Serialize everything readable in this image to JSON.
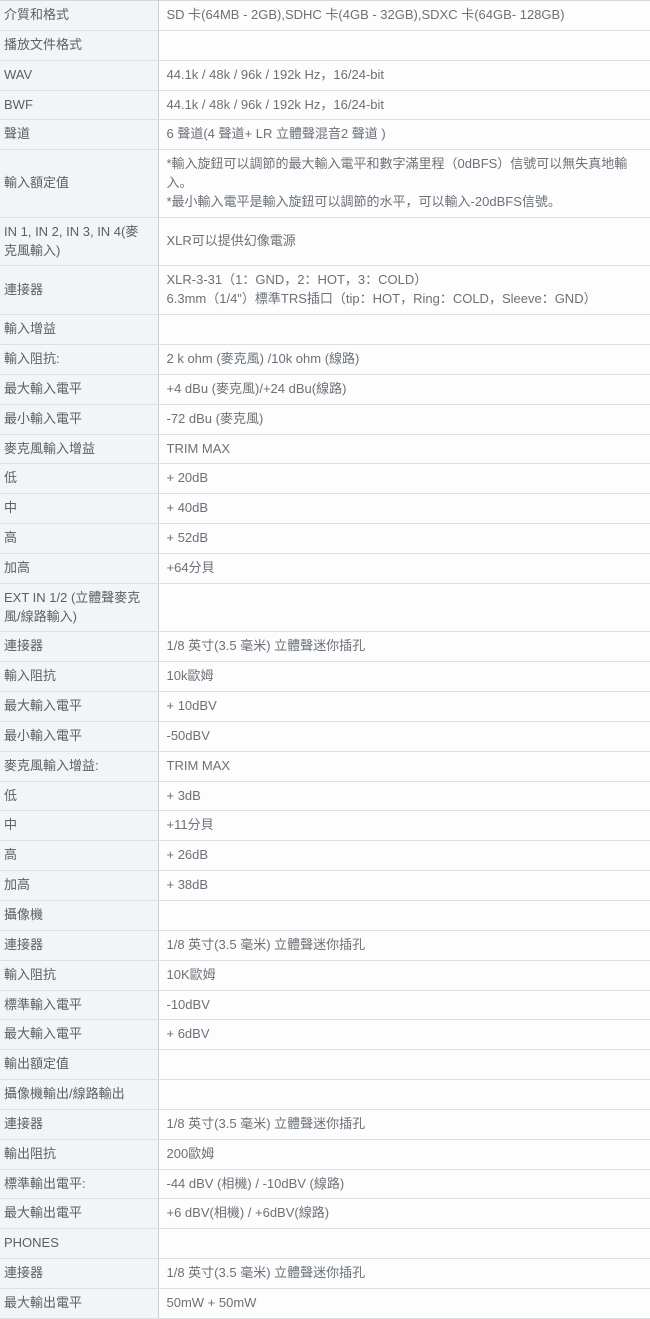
{
  "table": {
    "columns": [
      "spec-label",
      "spec-value"
    ],
    "rows": [
      {
        "type": "section-major",
        "label": "介質和格式",
        "value": "SD 卡(64MB - 2GB),SDHC 卡(4GB - 32GB),SDXC 卡(64GB- 128GB)"
      },
      {
        "type": "section-major",
        "label": "播放文件格式",
        "value": ""
      },
      {
        "type": "plain",
        "label": "WAV",
        "value": "44.1k / 48k / 96k / 192k Hz，16/24-bit"
      },
      {
        "type": "plain",
        "label": "BWF",
        "value": "44.1k / 48k / 96k / 192k Hz，16/24-bit"
      },
      {
        "type": "section-major",
        "label": "聲道",
        "value": "6 聲道(4 聲道+ LR 立體聲混音2 聲道 )"
      },
      {
        "type": "section-major",
        "label": "輸入額定值",
        "value": "*輸入旋鈕可以調節的最大輸入電平和數字滿里程（0dBFS）信號可以無失真地輸入。\n*最小輸入電平是輸入旋鈕可以調節的水平，可以輸入-20dBFS信號。"
      },
      {
        "type": "section-sub",
        "label": "IN 1, IN 2, IN 3, IN 4(麥克風輸入)",
        "value": "XLR可以提供幻像電源"
      },
      {
        "type": "plain",
        "label": "連接器",
        "value": "XLR-3-31（1：GND，2：HOT，3：COLD）\n6.3mm（1/4\"）標準TRS插口（tip：HOT，Ring：COLD，Sleeve：GND）"
      },
      {
        "type": "plain",
        "label": "輸入增益",
        "value": ""
      },
      {
        "type": "plain",
        "label": "輸入阻抗:",
        "value": "2 k ohm (麥克風) /10k ohm (線路)"
      },
      {
        "type": "plain",
        "label": "最大輸入電平",
        "value": "+4 dBu (麥克風)/+24 dBu(線路)"
      },
      {
        "type": "plain",
        "label": "最小輸入電平",
        "value": "-72 dBu (麥克風)"
      },
      {
        "type": "plain",
        "label": "麥克風輸入增益",
        "value": "TRIM MAX"
      },
      {
        "type": "plain",
        "label": "低",
        "value": "+ 20dB"
      },
      {
        "type": "plain",
        "label": "中",
        "value": "+ 40dB"
      },
      {
        "type": "plain",
        "label": "高",
        "value": "+ 52dB"
      },
      {
        "type": "plain",
        "label": "加高",
        "value": "+64分貝"
      },
      {
        "type": "section-sub",
        "label": "EXT IN 1/2 (立體聲麥克風/線路輸入)",
        "value": ""
      },
      {
        "type": "plain",
        "label": "連接器",
        "value": "1/8 英寸(3.5 毫米) 立體聲迷你插孔"
      },
      {
        "type": "plain",
        "label": "輸入阻抗",
        "value": "10k歐姆"
      },
      {
        "type": "plain",
        "label": "最大輸入電平",
        "value": "+ 10dBV"
      },
      {
        "type": "plain",
        "label": "最小輸入電平",
        "value": "-50dBV"
      },
      {
        "type": "plain",
        "label": "麥克風輸入增益:",
        "value": "TRIM MAX"
      },
      {
        "type": "plain",
        "label": "低",
        "value": "+ 3dB"
      },
      {
        "type": "plain",
        "label": "中",
        "value": "+11分貝"
      },
      {
        "type": "plain",
        "label": "高",
        "value": "+ 26dB"
      },
      {
        "type": "plain",
        "label": "加高",
        "value": "+ 38dB"
      },
      {
        "type": "section-sub",
        "label": "攝像機",
        "value": ""
      },
      {
        "type": "plain",
        "label": "連接器",
        "value": "1/8 英寸(3.5 毫米) 立體聲迷你插孔"
      },
      {
        "type": "plain",
        "label": "輸入阻抗",
        "value": "10K歐姆"
      },
      {
        "type": "plain",
        "label": "標準輸入電平",
        "value": "-10dBV"
      },
      {
        "type": "plain",
        "label": "最大輸入電平",
        "value": "+ 6dBV"
      },
      {
        "type": "section-major",
        "label": "輸出額定值",
        "value": ""
      },
      {
        "type": "section-sub",
        "label": "攝像機輸出/線路輸出",
        "value": ""
      },
      {
        "type": "plain",
        "label": "連接器",
        "value": "1/8 英寸(3.5 毫米) 立體聲迷你插孔"
      },
      {
        "type": "plain",
        "label": "輸出阻抗",
        "value": "200歐姆"
      },
      {
        "type": "plain",
        "label": "標準輸出電平:",
        "value": "-44 dBV (相機) / -10dBV (線路)"
      },
      {
        "type": "plain",
        "label": "最大輸出電平",
        "value": "+6 dBV(相機) / +6dBV(線路)"
      },
      {
        "type": "section-sub",
        "label": "PHONES",
        "value": ""
      },
      {
        "type": "plain",
        "label": "連接器",
        "value": "1/8 英寸(3.5 毫米) 立體聲迷你插孔"
      },
      {
        "type": "plain",
        "label": "最大輸出電平",
        "value": "50mW + 50mW"
      }
    ]
  },
  "colors": {
    "section_major_bg": "#e2e1f2",
    "section_sub_bg": "#e6e7e9",
    "label_bg": "#f3f4f6",
    "value_bg": "#fdfdfd",
    "border": "#dcdfe4",
    "text": "#6b7178"
  }
}
